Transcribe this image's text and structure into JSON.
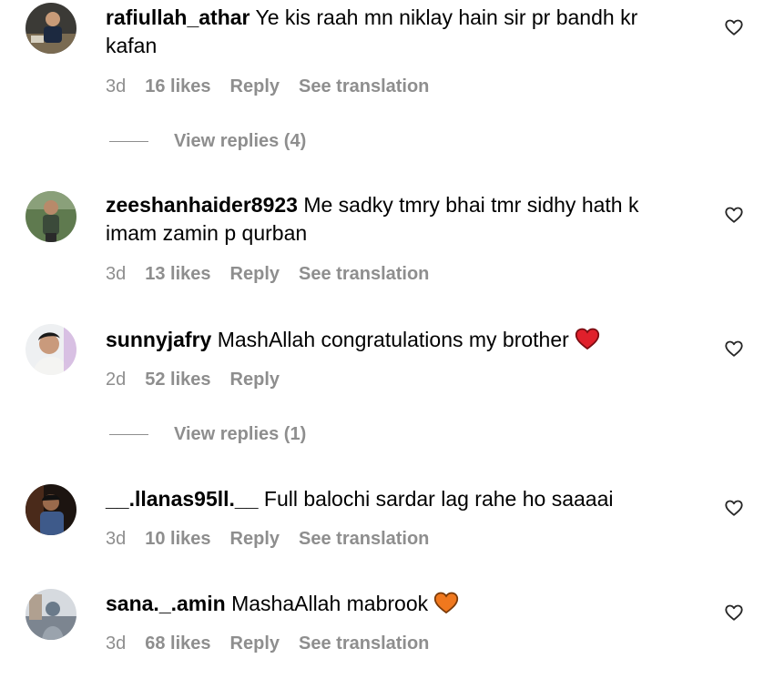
{
  "comments": [
    {
      "username": "rafiullah_athar",
      "text": "Ye kis raah mn niklay hain sir pr bandh kr kafan",
      "time": "3d",
      "likes": "16 likes",
      "reply": "Reply",
      "translation": "See translation",
      "view_replies": "View replies (4)"
    },
    {
      "username": "zeeshanhaider8923",
      "text": "Me sadky tmry bhai tmr sidhy hath k imam zamin p qurban",
      "time": "3d",
      "likes": "13 likes",
      "reply": "Reply",
      "translation": "See translation"
    },
    {
      "username": "sunnyjafry",
      "text": "MashAllah congratulations my brother",
      "emoji": "red-heart-emoji",
      "time": "2d",
      "likes": "52 likes",
      "reply": "Reply",
      "view_replies": "View replies (1)"
    },
    {
      "username": "__.llanas95ll.__",
      "text": "Full balochi sardar lag rahe ho saaaai",
      "time": "3d",
      "likes": "10 likes",
      "reply": "Reply",
      "translation": "See translation"
    },
    {
      "username": "sana._.amin",
      "text": "MashaAllah mabrook",
      "emoji": "orange-heart-emoji",
      "time": "3d",
      "likes": "68 likes",
      "reply": "Reply",
      "translation": "See translation"
    }
  ],
  "icons": {
    "like": "heart-outline-icon",
    "red_heart": "#e0202b",
    "orange_heart": "#f0781e"
  },
  "colors": {
    "meta_text": "#8e8e8e",
    "text": "#000000"
  }
}
